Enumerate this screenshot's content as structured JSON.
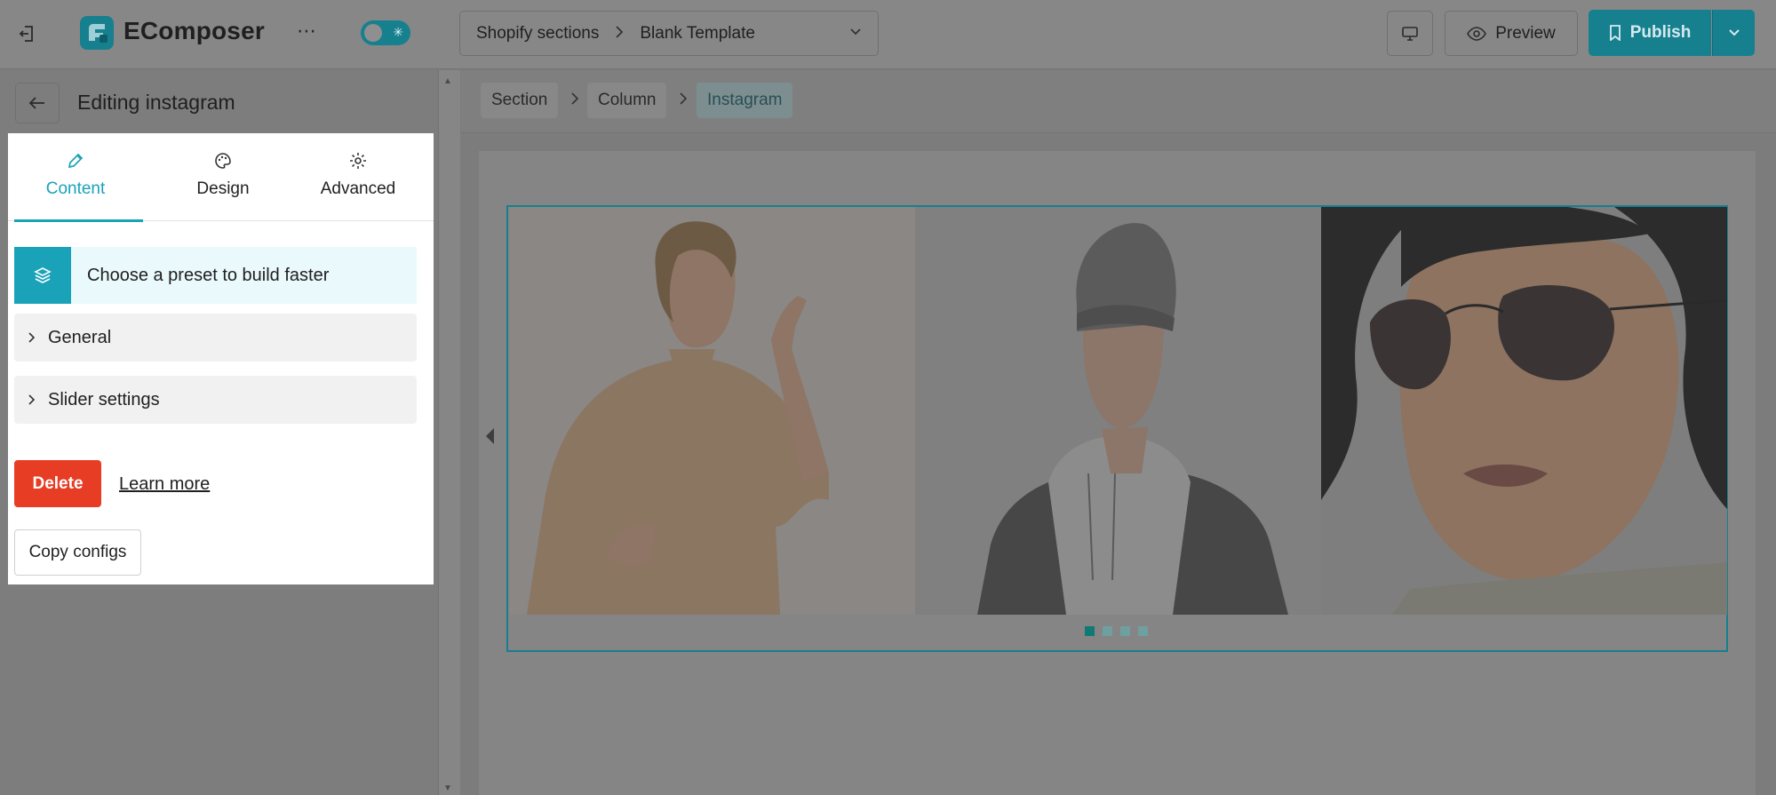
{
  "topbar": {
    "brand": "EComposer",
    "more": "⋯",
    "template_scope": "Shopify sections",
    "template_name": "Blank Template",
    "preview_label": "Preview",
    "publish_label": "Publish"
  },
  "sidebar": {
    "editing_title": "Editing instagram",
    "tabs": [
      {
        "label": "Content",
        "icon": "pencil-icon"
      },
      {
        "label": "Design",
        "icon": "palette-icon"
      },
      {
        "label": "Advanced",
        "icon": "gear-icon"
      }
    ],
    "preset_text": "Choose a preset to build faster",
    "sections": [
      "General",
      "Slider settings"
    ],
    "delete_label": "Delete",
    "learn_more_label": "Learn more",
    "copy_configs_label": "Copy configs"
  },
  "breadcrumb": [
    "Section",
    "Column",
    "Instagram"
  ],
  "slider": {
    "photos": [
      "woman-in-beige-sweater",
      "man-in-grey-beanie",
      "woman-in-sunglasses"
    ],
    "dots_total": 4,
    "active_dot": 1
  },
  "colors": {
    "accent": "#1aa3b8",
    "accent_dark": "#16808f",
    "delete": "#e63d24",
    "overlay": "#7c7c7c"
  }
}
